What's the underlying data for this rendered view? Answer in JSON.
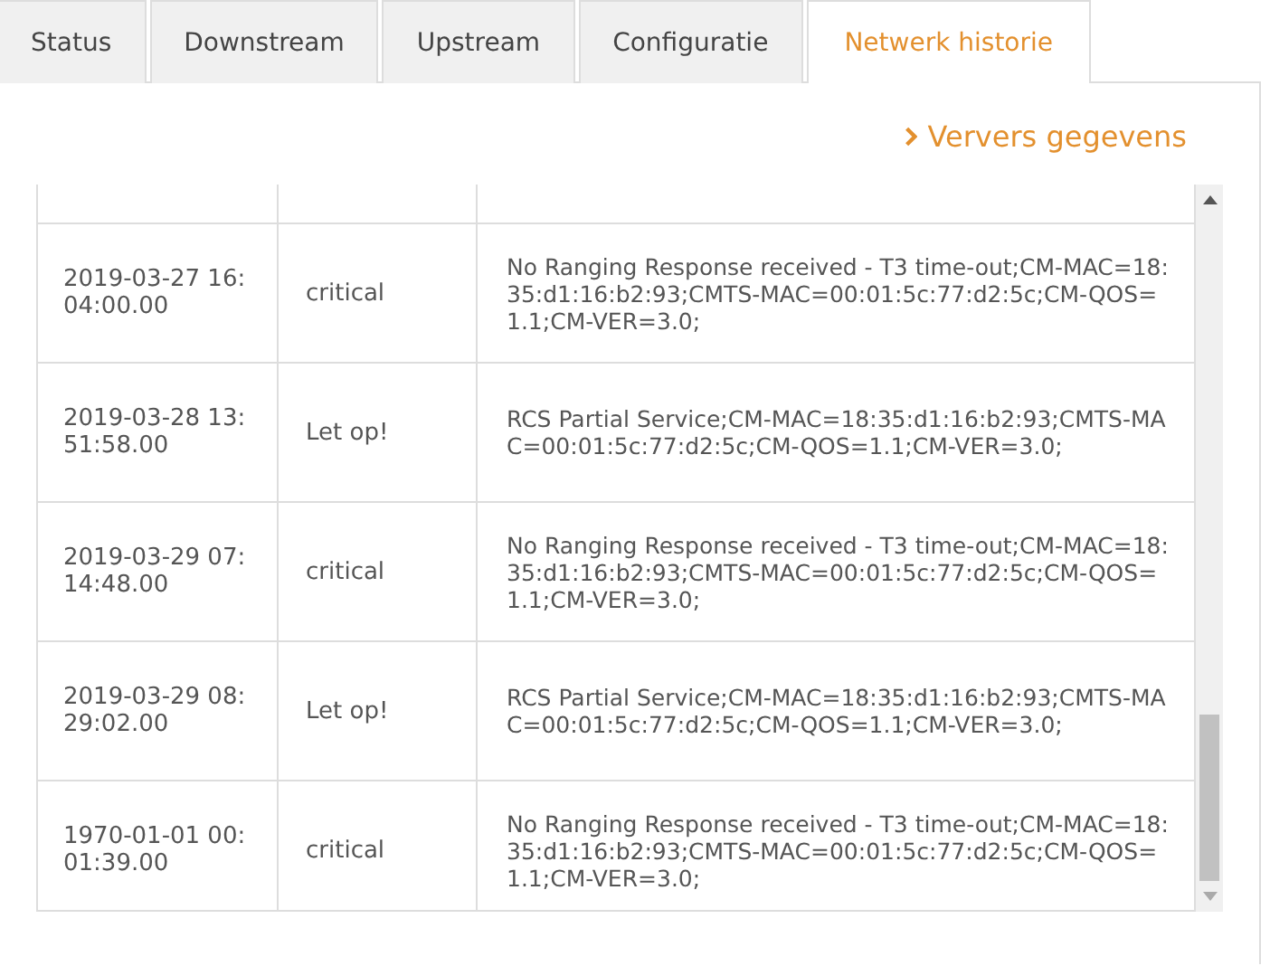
{
  "tabs": [
    {
      "label": "Status",
      "selected": false
    },
    {
      "label": "Downstream",
      "selected": false
    },
    {
      "label": "Upstream",
      "selected": false
    },
    {
      "label": "Configuratie",
      "selected": false
    },
    {
      "label": "Netwerk historie",
      "selected": true
    }
  ],
  "refresh_link": {
    "label": "Ververs gegevens"
  },
  "table": {
    "rows": [
      {
        "time": "2019-03-27 16:04:00.00",
        "level": "critical",
        "message": "No Ranging Response received - T3 time-out;CM-MAC=18:35:d1:16:b2:93;CMTS-MAC=00:01:5c:77:d2:5c;CM-QOS=1.1;CM-VER=3.0;"
      },
      {
        "time": "2019-03-28 13:51:58.00",
        "level": "Let op!",
        "message": "RCS Partial Service;CM-MAC=18:35:d1:16:b2:93;CMTS-MAC=00:01:5c:77:d2:5c;CM-QOS=1.1;CM-VER=3.0;"
      },
      {
        "time": "2019-03-29 07:14:48.00",
        "level": "critical",
        "message": "No Ranging Response received - T3 time-out;CM-MAC=18:35:d1:16:b2:93;CMTS-MAC=00:01:5c:77:d2:5c;CM-QOS=1.1;CM-VER=3.0;"
      },
      {
        "time": "2019-03-29 08:29:02.00",
        "level": "Let op!",
        "message": "RCS Partial Service;CM-MAC=18:35:d1:16:b2:93;CMTS-MAC=00:01:5c:77:d2:5c;CM-QOS=1.1;CM-VER=3.0;"
      },
      {
        "time": "1970-01-01 00:01:39.00",
        "level": "critical",
        "message": "No Ranging Response received - T3 time-out;CM-MAC=18:35:d1:16:b2:93;CMTS-MAC=00:01:5c:77:d2:5c;CM-QOS=1.1;CM-VER=3.0;"
      }
    ]
  }
}
